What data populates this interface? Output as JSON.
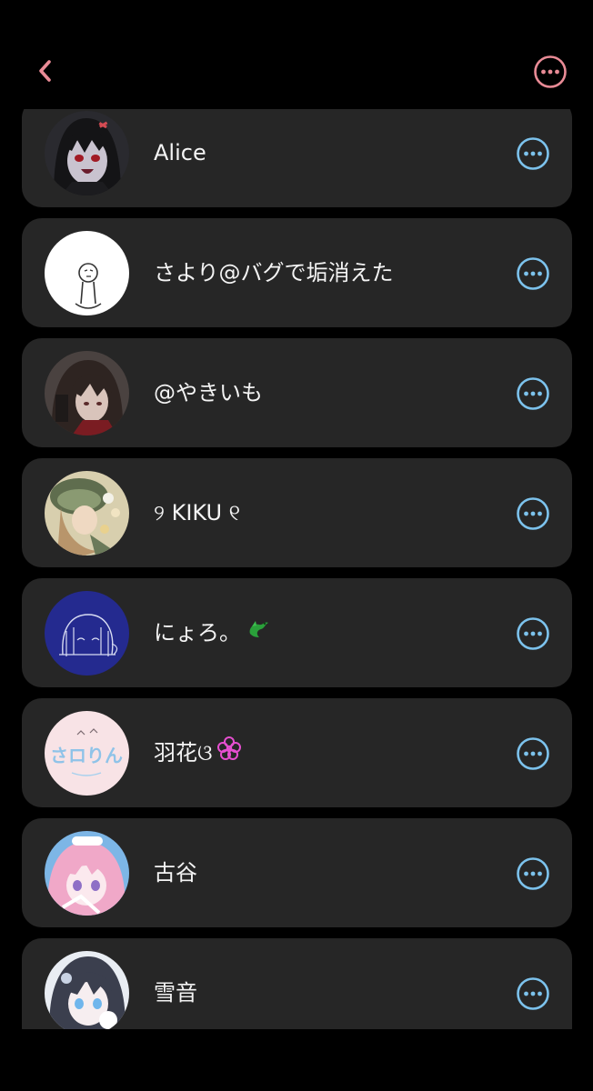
{
  "header": {
    "back_icon": "chevron-left-icon",
    "menu_icon": "more-horizontal-circle-icon",
    "accent_color": "#e98b96"
  },
  "item_action_icon": "more-horizontal-circle-icon",
  "item_action_color": "#7cc2ec",
  "users": [
    {
      "name": "Alice",
      "avatar": "dark-hair-anime-avatar"
    },
    {
      "name": "さより@バグで垢消えた",
      "avatar": "doodle-figure-avatar"
    },
    {
      "name": "@やきいも",
      "avatar": "brown-hair-anime-avatar"
    },
    {
      "name": "୨ KIKU ୧",
      "avatar": "green-hat-anime-avatar"
    },
    {
      "name": "にょろ。",
      "decoration": "🐉",
      "avatar": "blue-doodle-avatar"
    },
    {
      "name": "羽花ଓ",
      "decoration": "✿",
      "avatar": "pink-text-logo-avatar"
    },
    {
      "name": "古谷",
      "avatar": "pink-hair-anime-avatar"
    },
    {
      "name": "雪音",
      "avatar": "dark-hair-blue-eyes-avatar"
    }
  ]
}
